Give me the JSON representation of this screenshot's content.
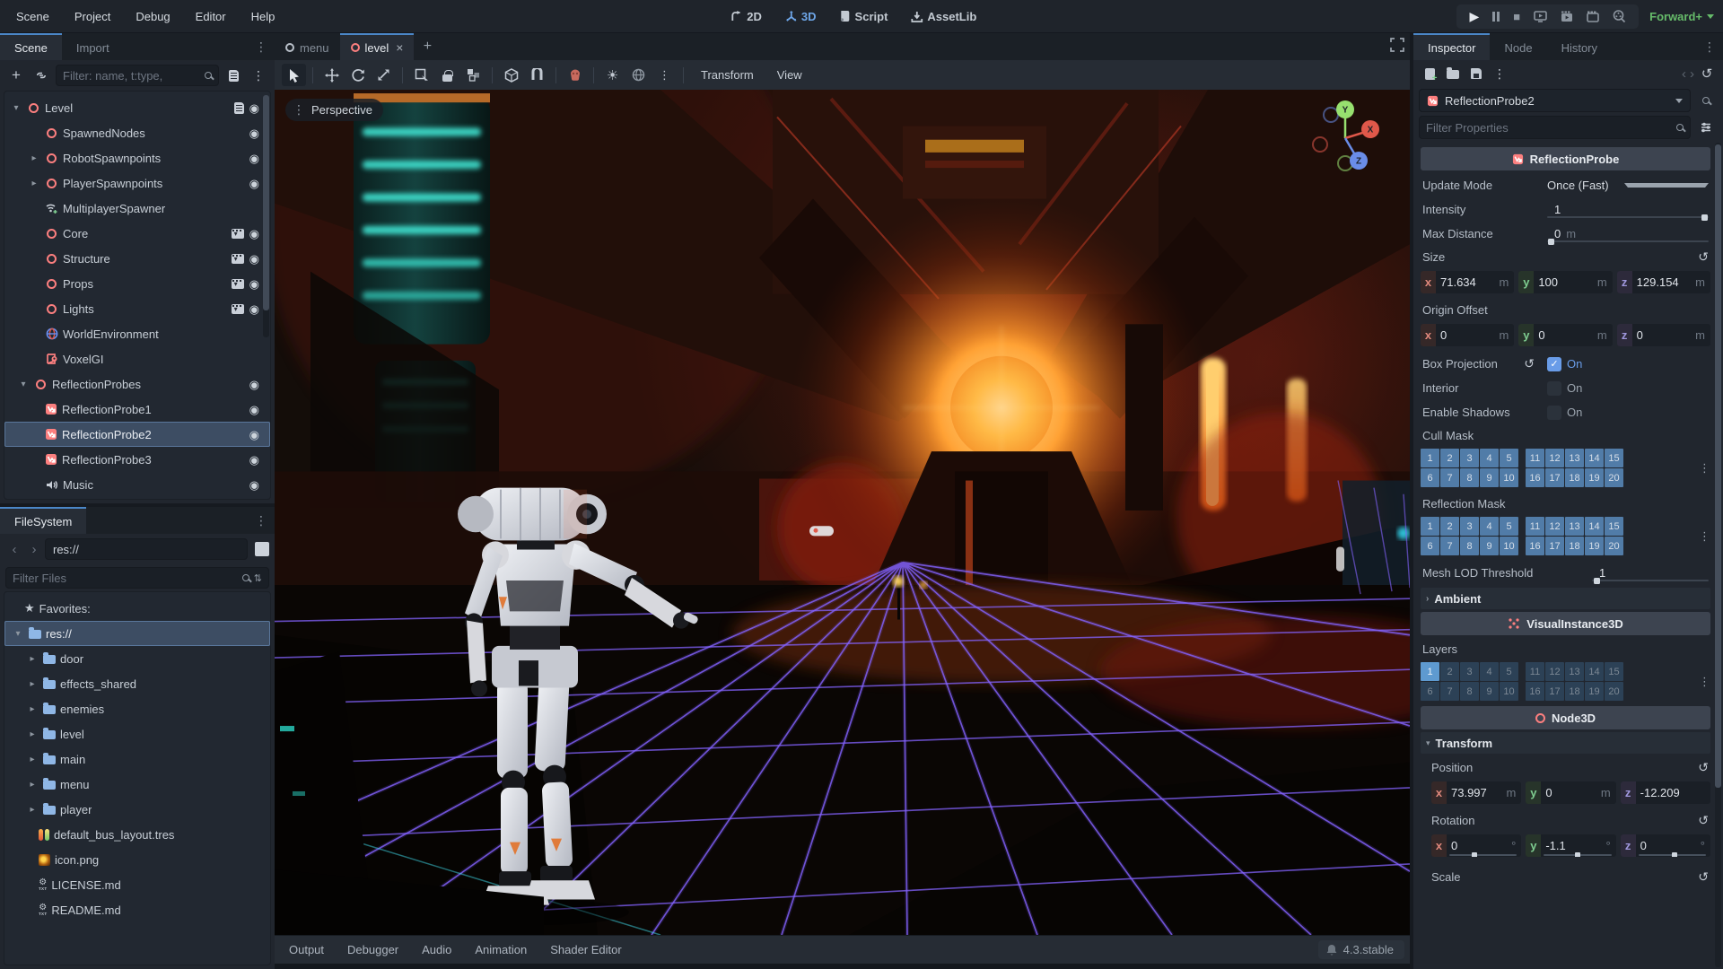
{
  "colors": {
    "accent_blue": "#699ce8",
    "tab_accent": "#4b87c8",
    "node_red": "#fc7f7f",
    "folder_blue": "#8fb7e6",
    "renderer_green": "#66bb6a",
    "mask_cell_on": "#517ca8",
    "layer_active": "#5e9ad0"
  },
  "menubar": {
    "items": [
      "Scene",
      "Project",
      "Debug",
      "Editor",
      "Help"
    ]
  },
  "switcher": {
    "items": [
      "2D",
      "3D",
      "Script",
      "AssetLib"
    ],
    "active": "3D"
  },
  "playback": {
    "renderer": "Forward+"
  },
  "scene_dock": {
    "tabs": {
      "scene": "Scene",
      "import": "Import"
    },
    "filter_placeholder": "Filter: name, t:type,",
    "nodes": [
      "Level",
      "SpawnedNodes",
      "RobotSpawnpoints",
      "PlayerSpawnpoints",
      "MultiplayerSpawner",
      "Core",
      "Structure",
      "Props",
      "Lights",
      "WorldEnvironment",
      "VoxelGI",
      "ReflectionProbes",
      "ReflectionProbe1",
      "ReflectionProbe2",
      "ReflectionProbe3",
      "Music"
    ],
    "selected_node": "ReflectionProbe2"
  },
  "filesystem": {
    "title": "FileSystem",
    "path": "res://",
    "filter_placeholder": "Filter Files",
    "favorites_label": "Favorites:",
    "md_icon_label": "TXT",
    "items": [
      "res://",
      "door",
      "effects_shared",
      "enemies",
      "level",
      "main",
      "menu",
      "player",
      "default_bus_layout.tres",
      "icon.png",
      "LICENSE.md",
      "README.md"
    ]
  },
  "viewport": {
    "tabs": [
      "menu",
      "level"
    ],
    "perspective_label": "Perspective",
    "menus": {
      "transform": "Transform",
      "view": "View"
    },
    "gizmo_axes": {
      "x": "X",
      "y": "Y",
      "z": "Z"
    }
  },
  "bottom_bar": {
    "tabs": [
      "Output",
      "Debugger",
      "Audio",
      "Animation",
      "Shader Editor"
    ],
    "version": "4.3.stable"
  },
  "inspector": {
    "tabs": {
      "inspector": "Inspector",
      "node": "Node",
      "history": "History"
    },
    "node_selector": "ReflectionProbe2",
    "filter_placeholder": "Filter Properties",
    "sections": {
      "reflection_probe": "ReflectionProbe",
      "visual_instance": "VisualInstance3D",
      "node3d": "Node3D"
    },
    "props": {
      "update_mode": {
        "label": "Update Mode",
        "value": "Once (Fast)"
      },
      "intensity": {
        "label": "Intensity",
        "value": "1"
      },
      "max_distance": {
        "label": "Max Distance",
        "value": "0",
        "unit": "m"
      },
      "size": {
        "label": "Size",
        "x": "71.634",
        "y": "100",
        "z": "129.154",
        "unit": "m"
      },
      "origin_offset": {
        "label": "Origin Offset",
        "x": "0",
        "y": "0",
        "z": "0",
        "unit": "m"
      },
      "box_projection": {
        "label": "Box Projection",
        "value": "On"
      },
      "interior": {
        "label": "Interior",
        "value": "On"
      },
      "enable_shadows": {
        "label": "Enable Shadows",
        "value": "On"
      },
      "cull_mask": {
        "label": "Cull Mask"
      },
      "reflection_mask": {
        "label": "Reflection Mask"
      },
      "mesh_lod": {
        "label": "Mesh LOD Threshold",
        "value": "1"
      },
      "ambient": {
        "label": "Ambient"
      },
      "layers": {
        "label": "Layers"
      },
      "transform": {
        "label": "Transform"
      },
      "position": {
        "label": "Position",
        "x": "73.997",
        "y": "0",
        "z": "-12.209",
        "unit": "m"
      },
      "rotation": {
        "label": "Rotation",
        "x": "0",
        "y": "-1.1",
        "z": "0",
        "unit": "°"
      },
      "scale": {
        "label": "Scale"
      }
    },
    "masks": {
      "row1": [
        1,
        2,
        3,
        4,
        5,
        11,
        12,
        13,
        14,
        15
      ],
      "row2": [
        6,
        7,
        8,
        9,
        10,
        16,
        17,
        18,
        19,
        20
      ],
      "layers_active": [
        1
      ]
    }
  }
}
